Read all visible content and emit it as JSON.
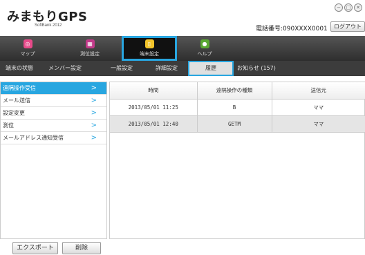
{
  "header": {
    "logo": "みまもりGPS",
    "logo_sub": "SoftBank 2012",
    "phone": "電話番号:090XXXX0001",
    "logout_label": "ログアウト",
    "window_buttons": [
      "−",
      "□",
      "✕"
    ]
  },
  "main_nav": [
    {
      "label": "マップ",
      "icon": "map-pin-icon",
      "color": "#e84a8a"
    },
    {
      "label": "測位設定",
      "icon": "calendar-icon",
      "color": "#c23a8a"
    },
    {
      "label": "端末設定",
      "icon": "phone-device-icon",
      "color": "#f3c42a"
    },
    {
      "label": "ヘルプ",
      "icon": "help-person-icon",
      "color": "#5aa832"
    }
  ],
  "sub_nav": [
    {
      "label": "端末の状態"
    },
    {
      "label": "メンバー設定"
    },
    {
      "label": "一般設定"
    },
    {
      "label": "詳細設定"
    },
    {
      "label": "履歴"
    },
    {
      "label": "お知らせ (157)"
    }
  ],
  "sidebar": [
    {
      "label": "遠隔操作受信"
    },
    {
      "label": "メール送信"
    },
    {
      "label": "設定変更"
    },
    {
      "label": "測位"
    },
    {
      "label": "メールアドレス通知受信"
    }
  ],
  "table": {
    "headers": [
      "時間",
      "遠隔操作の種類",
      "送信元"
    ],
    "rows": [
      [
        "2013/05/01 11:25",
        "B",
        "ママ"
      ],
      [
        "2013/05/01 12:40",
        "GETM",
        "ママ"
      ]
    ]
  },
  "buttons": {
    "export": "エクスポート",
    "delete": "削除"
  },
  "colors": {
    "accent": "#28a6e0"
  }
}
